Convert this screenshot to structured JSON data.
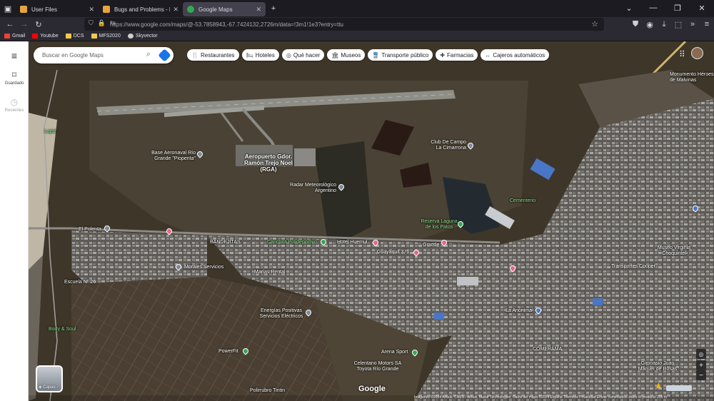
{
  "browser": {
    "tabs": [
      {
        "title": "User Files",
        "color": "#e8a33d"
      },
      {
        "title": "Bugs and Problems - ED Forum",
        "color": "#e8a33d"
      },
      {
        "title": "Google Maps",
        "color": "#34a853",
        "active": true
      }
    ],
    "url": "https://www.google.com/maps/@-53.7858943,-67.7424132,2726m/data=!3m1!1e3?entry=ttu",
    "bookmarks": [
      {
        "label": "Gmail",
        "color": "#ea4335"
      },
      {
        "label": "Youtube",
        "color": "#ff0000"
      },
      {
        "label": "DCS",
        "color": "#f2c94c"
      },
      {
        "label": "MFS2020",
        "color": "#f2c94c"
      },
      {
        "label": "Skyvector",
        "color": "#cfcfcf"
      }
    ]
  },
  "rail": {
    "menu_icon": "hamburger-icon",
    "saved": "Guardado",
    "recent": "Recientes"
  },
  "search": {
    "placeholder": "Buscar en Google Maps"
  },
  "chips": [
    {
      "label": "Restaurantes",
      "icon": "🍴"
    },
    {
      "label": "Hoteles",
      "icon": "🛏"
    },
    {
      "label": "Qué hacer",
      "icon": "◎"
    },
    {
      "label": "Museos",
      "icon": "🏛"
    },
    {
      "label": "Transporte público",
      "icon": "🚆"
    },
    {
      "label": "Farmacias",
      "icon": "✚"
    },
    {
      "label": "Cajeros automáticos",
      "icon": "↔"
    }
  ],
  "places": {
    "airport": "Aeropuerto Gdor. Ramón Trejo Noel (RGA)",
    "naval": "Base Aeronaval Río Grande \"Piopenta\"",
    "radar": "Radar Meteorológico Argentino",
    "club": "Club De Campo La Cimarrona",
    "laguna": "Reserva Laguna de los Patos",
    "monument": "Monumento Héroes de Malvinas",
    "polenta": "El Polenta",
    "escuela": "Escuela Nº 26",
    "morales": "Morales Servicios",
    "marias": "Marías Rental",
    "bandejitas": "BANDEJITAS",
    "canchita": "Canchita Polideportivo",
    "huemul": "Hotel Huemul",
    "guayaquil": "Guayaquil 376",
    "energias": "Energías Positivas Servicios Eléctricos",
    "powerfit": "PowerFit",
    "arena": "Arena Sport",
    "celentano": "Celentano Motors SA Toyota Río Grande",
    "polirrubro": "Polirrubro Tintin",
    "lapiz": "Lapiz",
    "cementerio": "Cementerio",
    "anonima": "La Anónima",
    "museo": "Museo Virginia Choquintel",
    "comerama": "COMERAMA",
    "gimnasio": "Gimnasio Juan Manuel de Rosas",
    "transportes": "Transportes Cooper",
    "bodysoul": "Body & Soul",
    "grande": "Grande"
  },
  "layers_label": "Capas",
  "google_logo": "Google",
  "footer": "Imágenes ©2024 Airbus, CNES / Airbus, Maxar Technologies, Datos del mapa ©2024   España   Términos   Privacidad   Enviar comentarios sobre el producto   200 m",
  "controls": {
    "zoom_in": "+",
    "zoom_out": "−"
  }
}
